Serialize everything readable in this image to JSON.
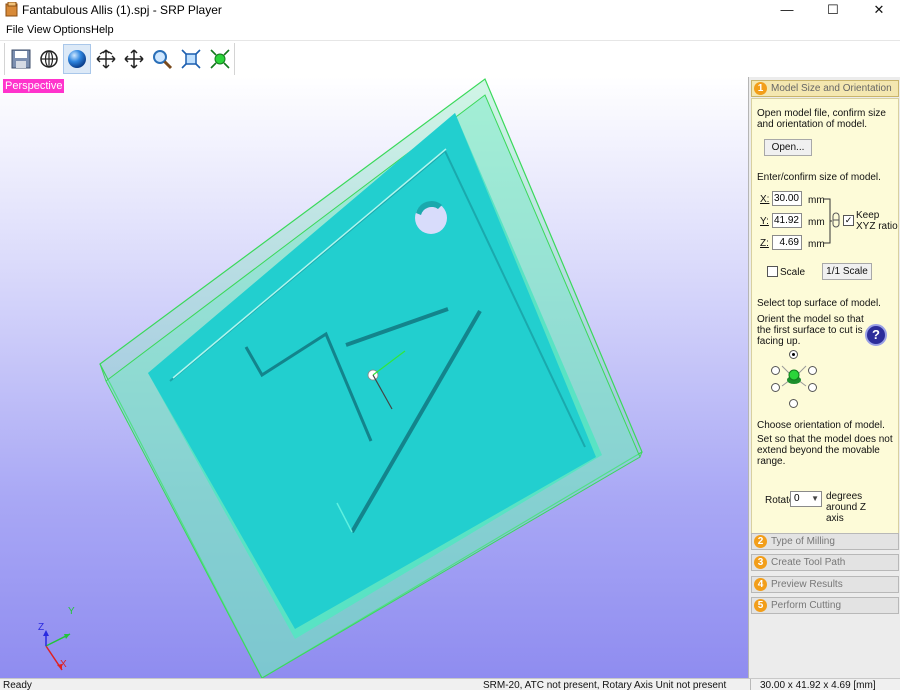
{
  "window": {
    "title": "Fantabulous Allis (1).spj - SRP Player",
    "minimize": "—",
    "maximize": "☐",
    "close": "✕"
  },
  "menu": [
    "File",
    "View",
    "Options",
    "Help"
  ],
  "toolbar": {
    "buttons": [
      {
        "icon": "save-icon"
      },
      {
        "icon": "globe-icon"
      },
      {
        "icon": "sphere-icon",
        "active": true
      },
      {
        "icon": "rotate-icon"
      },
      {
        "icon": "pan-icon"
      },
      {
        "icon": "zoom-icon"
      },
      {
        "icon": "fit-view-icon"
      },
      {
        "icon": "fit-model-icon"
      }
    ]
  },
  "viewport": {
    "label": "Perspective",
    "axes": {
      "x": "X",
      "y": "Y",
      "z": "Z"
    },
    "colors": {
      "label_bg": "#ff33cc",
      "model": "#22cfcf",
      "stock": "#5ee8b8"
    }
  },
  "panel": {
    "steps": [
      {
        "num": "1",
        "label": "Model Size and Orientation",
        "open": true
      },
      {
        "num": "2",
        "label": "Type of Milling"
      },
      {
        "num": "3",
        "label": "Create Tool Path"
      },
      {
        "num": "4",
        "label": "Preview Results"
      },
      {
        "num": "5",
        "label": "Perform Cutting"
      }
    ],
    "step1": {
      "intro": "Open model file, confirm size and orientation of model.",
      "open_button": "Open...",
      "size_label": "Enter/confirm size of model.",
      "x_label": "X:",
      "x_value": "30.00",
      "y_label": "Y:",
      "y_value": "41.92",
      "z_label": "Z:",
      "z_value": "4.69",
      "unit": "mm",
      "keep_ratio_label": "Keep XYZ ratio",
      "keep_ratio_checked": true,
      "scale_label": "Scale",
      "scale_checked": false,
      "one_to_one_button": "1/1 Scale",
      "top_surface_title": "Select top surface of model.",
      "top_surface_text": "Orient the model so that the first surface to cut is facing up.",
      "help": "?",
      "orientation_title": "Choose orientation of model.",
      "orientation_text": "Set so that the model does not extend beyond the movable range.",
      "rotate_label": "Rotate",
      "rotate_value": "0",
      "rotate_suffix": "degrees around Z axis"
    }
  },
  "status": {
    "left": "Ready",
    "middle": "SRM-20, ATC not present, Rotary Axis Unit not present",
    "right": "30.00 x 41.92 x 4.69 [mm]"
  }
}
